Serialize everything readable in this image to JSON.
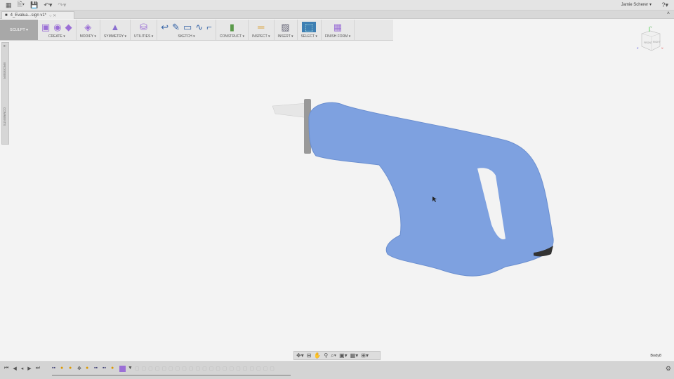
{
  "app": {
    "user": "Jamie Scherer",
    "doc_tab": "4_Evalua...sign v1*"
  },
  "toolbar": {
    "workspace": "SCULPT ▾",
    "groups": [
      {
        "label": "CREATE ▾"
      },
      {
        "label": "MODIFY ▾"
      },
      {
        "label": "SYMMETRY ▾"
      },
      {
        "label": "UTILITIES ▾"
      },
      {
        "label": "SKETCH ▾"
      },
      {
        "label": "CONSTRUCT ▾"
      },
      {
        "label": "INSPECT ▾"
      },
      {
        "label": "INSERT ▾"
      },
      {
        "label": "SELECT ▾"
      },
      {
        "label": "FINISH FORM ▾"
      }
    ]
  },
  "side": {
    "browser": "BROWSER",
    "comments": "COMMENTS"
  },
  "viewcube": {
    "front": "FRONT",
    "right": "RIGHT",
    "x": "X",
    "y": "Y",
    "z": "Z"
  },
  "status": {
    "body": "Body8"
  },
  "colors": {
    "model": "#7ea1e0",
    "select": "#3e7fb3"
  }
}
